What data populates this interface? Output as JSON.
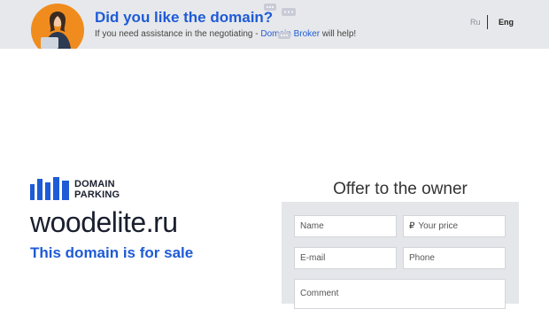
{
  "banner": {
    "title": "Did you like the domain?",
    "subtitle_before": "If you need assistance in the negotiating - ",
    "subtitle_link": "Domain Broker",
    "subtitle_after": " will help!",
    "lang_ru": "Ru",
    "lang_en": "Eng"
  },
  "logo": {
    "line1": "DOMAIN",
    "line2": "PARKING"
  },
  "domain": {
    "name": "woodelite.ru",
    "status": "This domain is for sale"
  },
  "offer": {
    "title": "Offer to the owner",
    "name_placeholder": "Name",
    "price_symbol": "₽",
    "price_placeholder": "Your price",
    "email_placeholder": "E-mail",
    "phone_placeholder": "Phone",
    "comment_placeholder": "Comment"
  },
  "colors": {
    "accent": "#1e5bd6",
    "banner_bg": "#e7e8eb",
    "form_bg": "#e4e6ea",
    "avatar_orange": "#f08c1e"
  }
}
